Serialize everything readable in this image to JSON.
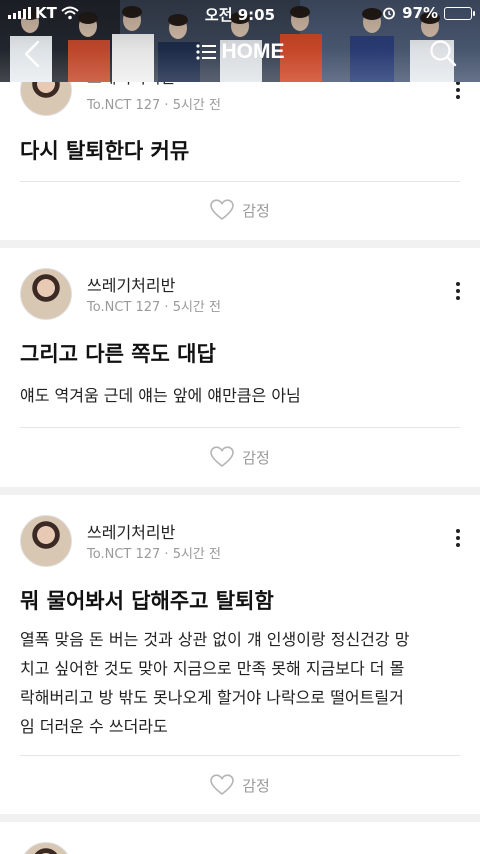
{
  "status_bar": {
    "carrier": "KT",
    "time": "오전 9:05",
    "battery": "97%",
    "battery_level": 0.97
  },
  "header": {
    "title": "HOME",
    "back_icon": "chevron-left-icon",
    "menu_icon": "list-icon",
    "search_icon": "search-icon"
  },
  "posts": [
    {
      "author": "쓰레기처리반",
      "community": "To.NCT 127",
      "time_ago": "5시간 전",
      "title": "다시 탈퇴한다 커뮤",
      "body": "",
      "reaction_label": "감정"
    },
    {
      "author": "쓰레기처리반",
      "community": "To.NCT 127",
      "time_ago": "5시간 전",
      "title": "그리고 다른 쪽도 대답",
      "body": "얘도 역겨움 근데 얘는 앞에 얘만큼은 아님",
      "reaction_label": "감정"
    },
    {
      "author": "쓰레기처리반",
      "community": "To.NCT 127",
      "time_ago": "5시간 전",
      "title": "뭐 물어봐서 답해주고 탈퇴함",
      "body_lines": [
        "열폭 맞음 돈 버는 것과 상관 없이 걔 인생이랑 정신건강 망",
        "치고 싶어한 것도 맞아 지금으로 만족 못해 지금보다 더 몰",
        "락해버리고  방 밖도 못나오게 할거야 나락으로 떨어트릴거",
        "임 더러운 수 쓰더라도"
      ],
      "reaction_label": "감정"
    }
  ],
  "colors": {
    "meta_text": "#9a9a9a",
    "separator": "#f1f1f1",
    "divider": "#e6e6e6"
  }
}
